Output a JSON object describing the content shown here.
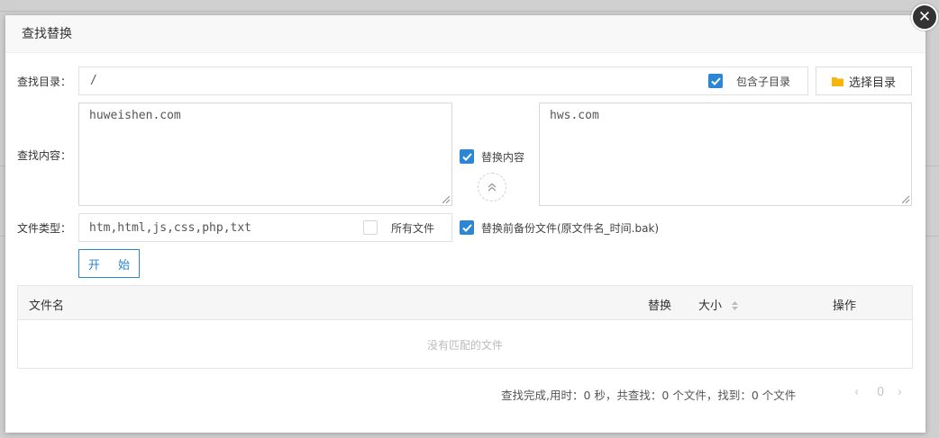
{
  "dialog": {
    "title": "查找替换"
  },
  "form": {
    "dir_label": "查找目录：",
    "dir_value": "/",
    "include_subdirs": {
      "label": "包含子目录",
      "checked": true
    },
    "choose_dir_button": "选择目录",
    "content_label": "查找内容：",
    "find_text": "huweishen.com",
    "replace_text": "hws.com",
    "replace_content": {
      "label": "替换内容",
      "checked": true
    },
    "filetype_label": "文件类型：",
    "filetype_value": "htm,html,js,css,php,txt",
    "all_files": {
      "label": "所有文件",
      "checked": false
    },
    "backup": {
      "label": "替换前备份文件(原文件名_时间.bak)",
      "checked": true
    },
    "start_button": "开 始"
  },
  "table": {
    "columns": [
      "文件名",
      "替换",
      "大小",
      "操作"
    ],
    "empty_text": "没有匹配的文件"
  },
  "status": {
    "text": "查找完成,用时：0 秒，共查找：0 个文件，找到：0 个文件"
  },
  "pager": {
    "prev": "‹",
    "page": "0",
    "next": "›"
  },
  "colors": {
    "accent": "#2b87d3",
    "folder_icon": "#f5b50a",
    "close_bg": "#333333"
  }
}
